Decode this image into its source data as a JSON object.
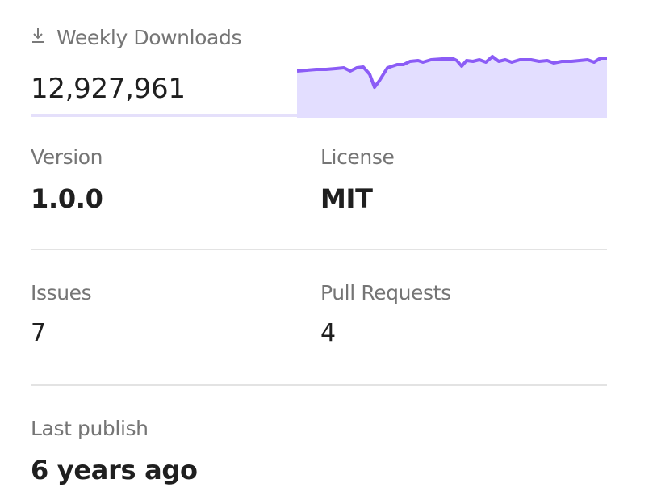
{
  "downloads": {
    "label": "Weekly Downloads",
    "icon": "download-icon",
    "count": "12,927,961",
    "sparkline": {
      "line_color": "#8b5cf6",
      "fill_color": "#e3deff"
    }
  },
  "stats": {
    "version": {
      "label": "Version",
      "value": "1.0.0"
    },
    "license": {
      "label": "License",
      "value": "MIT"
    },
    "issues": {
      "label": "Issues",
      "value": "7"
    },
    "pull_requests": {
      "label": "Pull Requests",
      "value": "4"
    },
    "last_publish": {
      "label": "Last publish",
      "value": "6 years ago"
    }
  }
}
